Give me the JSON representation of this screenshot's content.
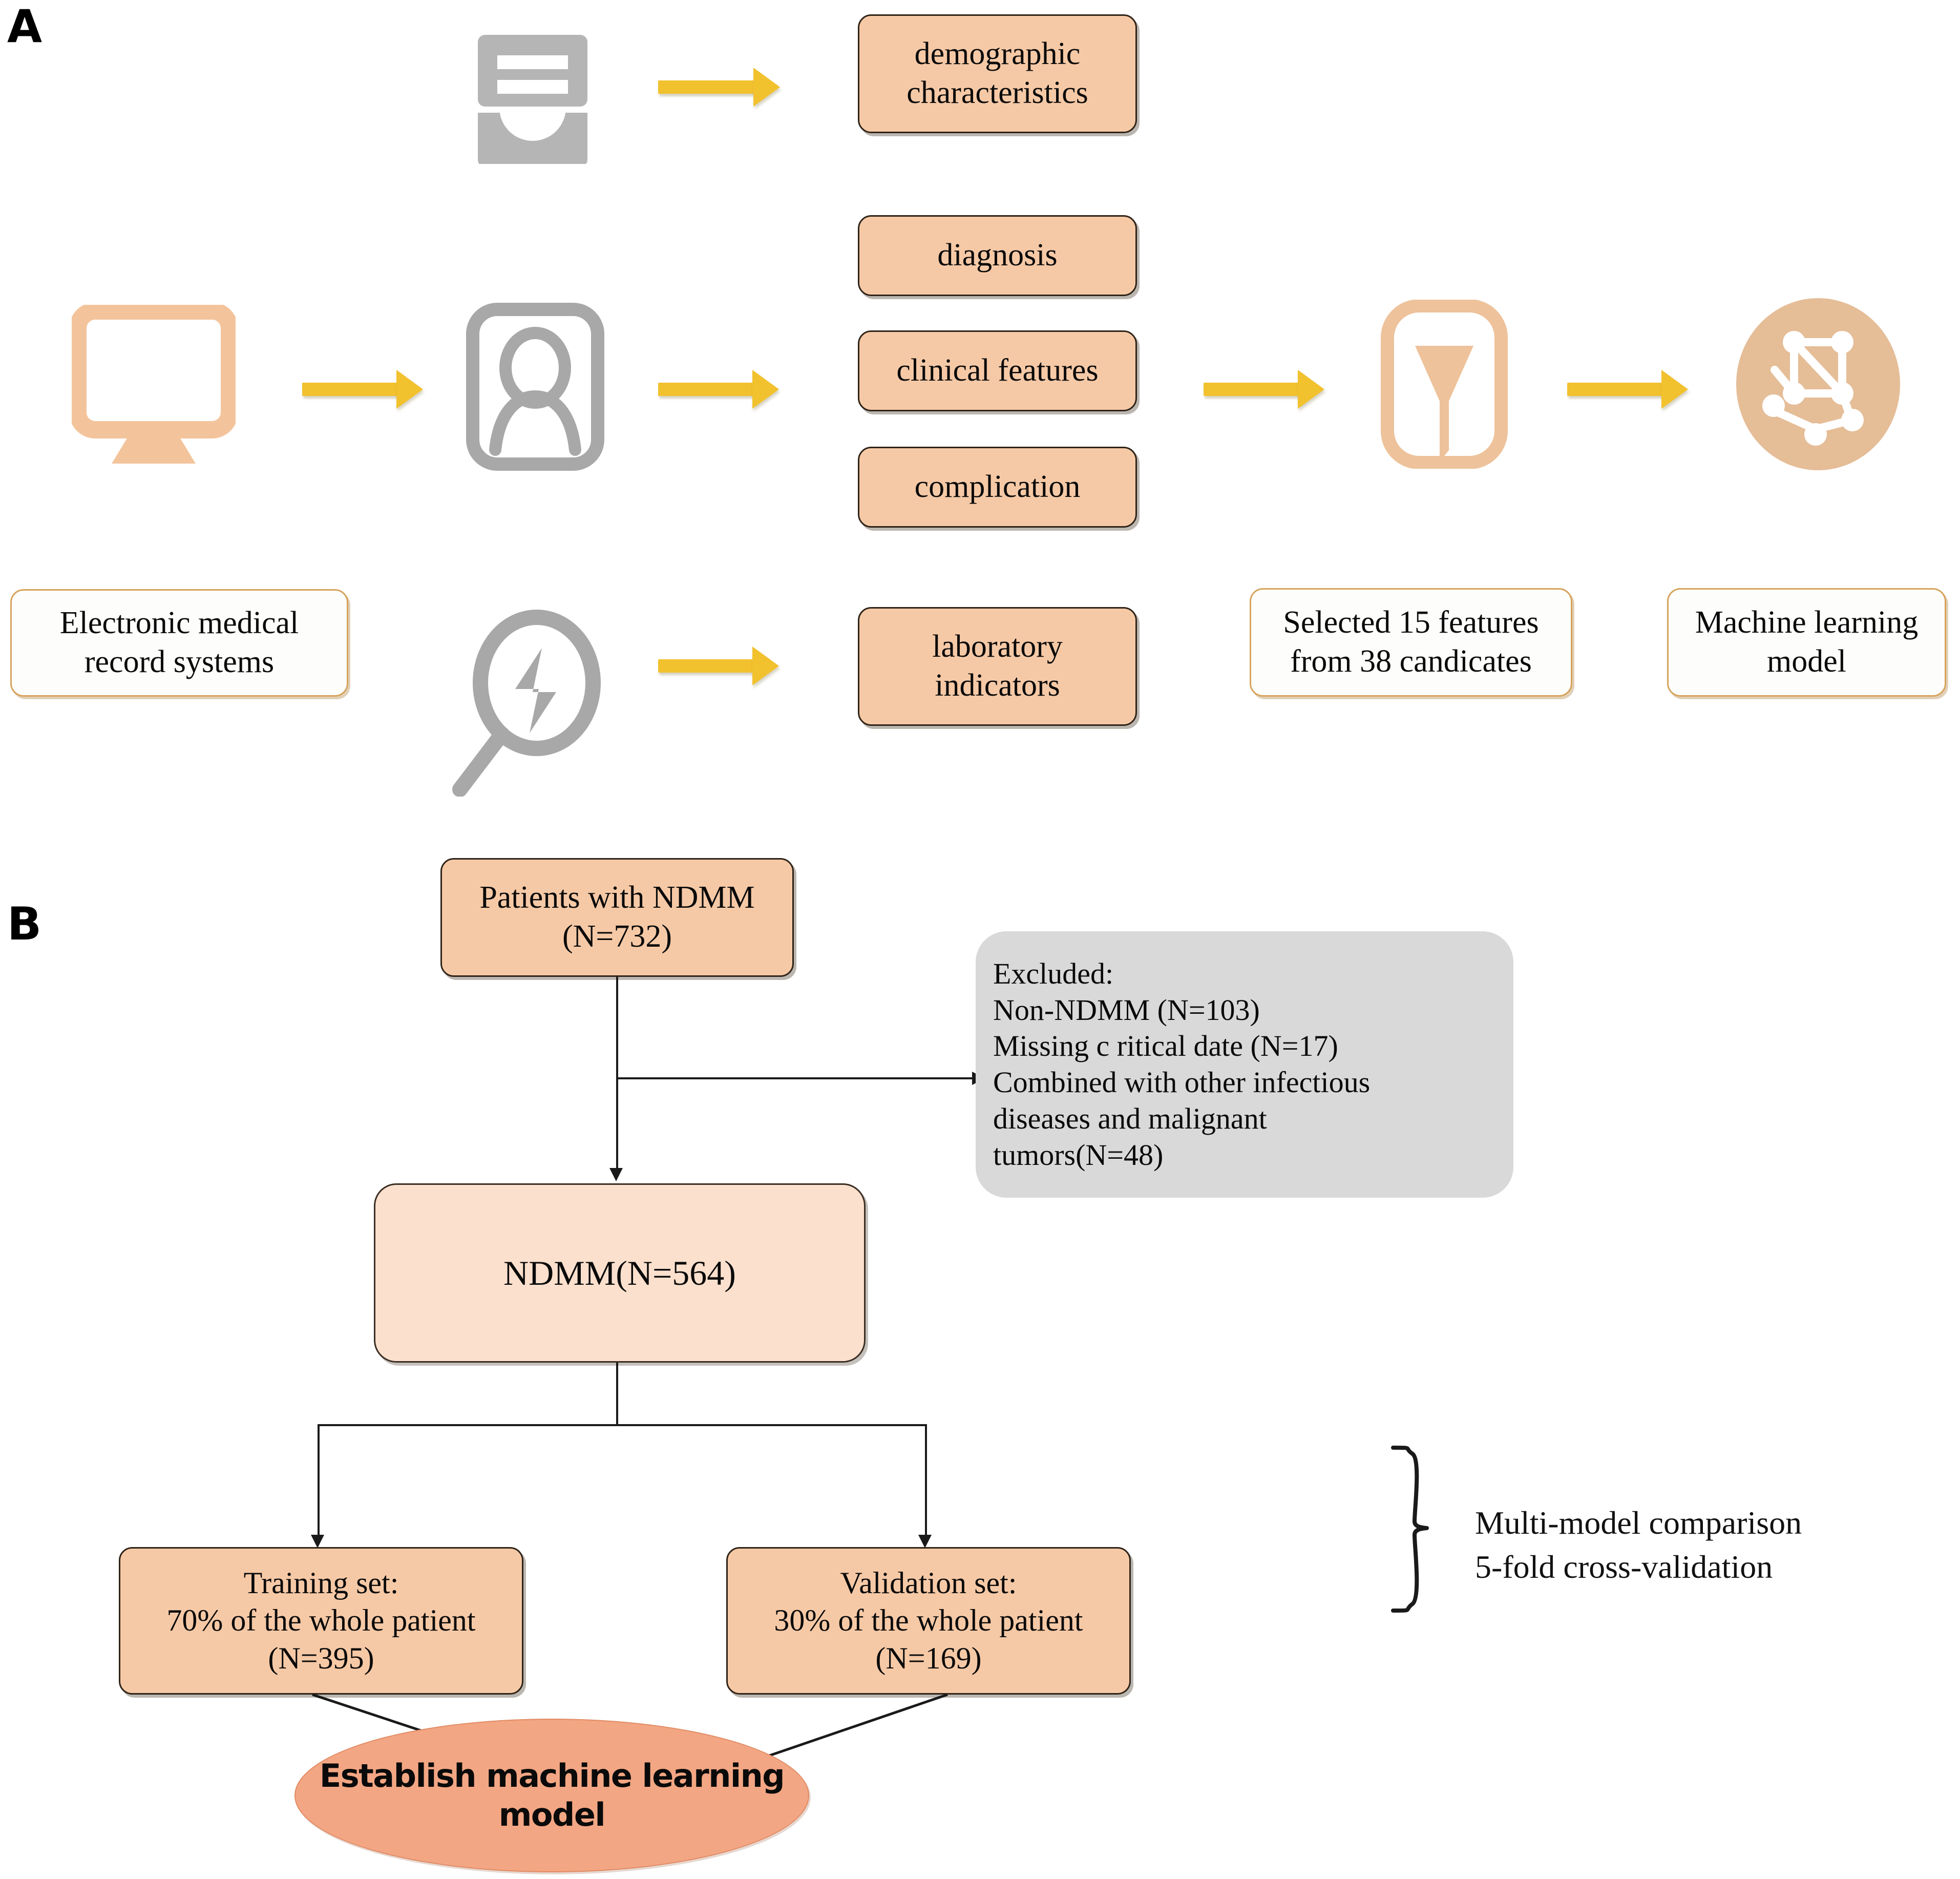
{
  "figure": {
    "panels": [
      {
        "letter": "A"
      },
      {
        "letter": "B"
      }
    ]
  },
  "panel_a": {
    "source": {
      "label": "Electronic medical\nrecord systems"
    },
    "icons": {
      "archive": "file-archive-icon",
      "monitor": "desktop-monitor-icon",
      "person_card": "person-id-card-icon",
      "magnifier": "magnifier-lightning-icon",
      "funnel": "funnel-filter-icon",
      "network": "neural-network-icon"
    },
    "categories": [
      {
        "label": "demographic\ncharacteristics"
      },
      {
        "label": "diagnosis"
      },
      {
        "label": "clinical features"
      },
      {
        "label": "complication"
      },
      {
        "label": "laboratory\nindicators"
      }
    ],
    "selection": {
      "label": "Selected 15 features\nfrom 38 candicates",
      "selected_count": 15,
      "candidate_count": 38
    },
    "model": {
      "label": "Machine learning\nmodel"
    },
    "arrow_color": "#f2c12e"
  },
  "panel_b": {
    "cohort": {
      "label": "Patients with NDMM\n(N=732)",
      "n": 732
    },
    "excluded": {
      "title": "Excluded:",
      "lines": [
        "Non-NDMM   (N=103)",
        "Missing c ritical date  (N=17)",
        "Combined with other infectious",
        "diseases and malignant",
        "tumors(N=48)"
      ],
      "text": "Excluded:\n Non-NDMM   (N=103)\nMissing c ritical date  (N=17)\nCombined with other infectious\ndiseases and malignant\ntumors(N=48)"
    },
    "included": {
      "label": "NDMM(N=564)",
      "n": 564
    },
    "training_set": {
      "label": "Training set:\n70% of the whole patient\n(N=395)",
      "percent": 70,
      "n": 395
    },
    "validation_set": {
      "label": "Validation set:\n30% of the whole patient\n(N=169)",
      "percent": 30,
      "n": 169
    },
    "evaluation_note": {
      "label": "Multi-model comparison\n5-fold cross-validation"
    },
    "outcome": {
      "label": "Establish machine learning\nmodel"
    },
    "colors": {
      "box_fill": "#f6c9a6",
      "box_fill_light": "#fbe0cd",
      "excluded_fill": "#d9d9d9",
      "ellipse_fill": "#f3a683",
      "connector": "#1a1a1a"
    }
  }
}
